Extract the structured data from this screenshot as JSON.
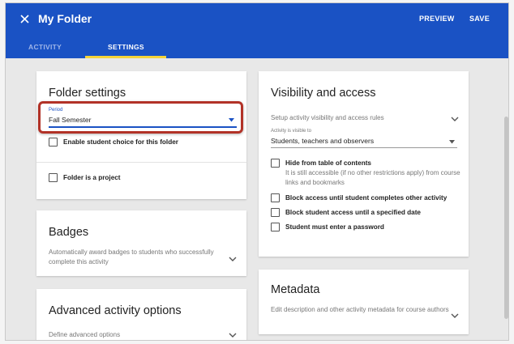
{
  "header": {
    "title": "My Folder",
    "preview_label": "PREVIEW",
    "save_label": "SAVE",
    "background_color": "#1a52c4"
  },
  "tabs": [
    {
      "label": "ACTIVITY",
      "active": false
    },
    {
      "label": "SETTINGS",
      "active": true
    }
  ],
  "folder_settings": {
    "title": "Folder settings",
    "period": {
      "label": "Period",
      "value": "Fall Semester"
    },
    "student_choice_label": "Enable student choice for this folder",
    "project_label": "Folder is a project"
  },
  "badges": {
    "title": "Badges",
    "description": "Automatically award badges to students who successfully complete this activity"
  },
  "advanced": {
    "title": "Advanced activity options",
    "description": "Define advanced options"
  },
  "visibility": {
    "title": "Visibility and access",
    "setup_text": "Setup activity visibility and access rules",
    "visible_to": {
      "label": "Activity is visible to",
      "value": "Students, teachers and observers"
    },
    "hide_toc_label": "Hide from table of contents",
    "hide_toc_note": "It is still accessible (if no other restrictions apply) from course links and bookmarks",
    "block_until_complete_label": "Block access until student completes other activity",
    "block_until_date_label": "Block student access until a specified date",
    "password_label": "Student must enter a password"
  },
  "metadata": {
    "title": "Metadata",
    "description": "Edit description and other activity metadata for course authors"
  },
  "colors": {
    "accent": "#1a52c4",
    "tab_indicator": "#f5d43a",
    "highlight_border": "#b23227"
  }
}
